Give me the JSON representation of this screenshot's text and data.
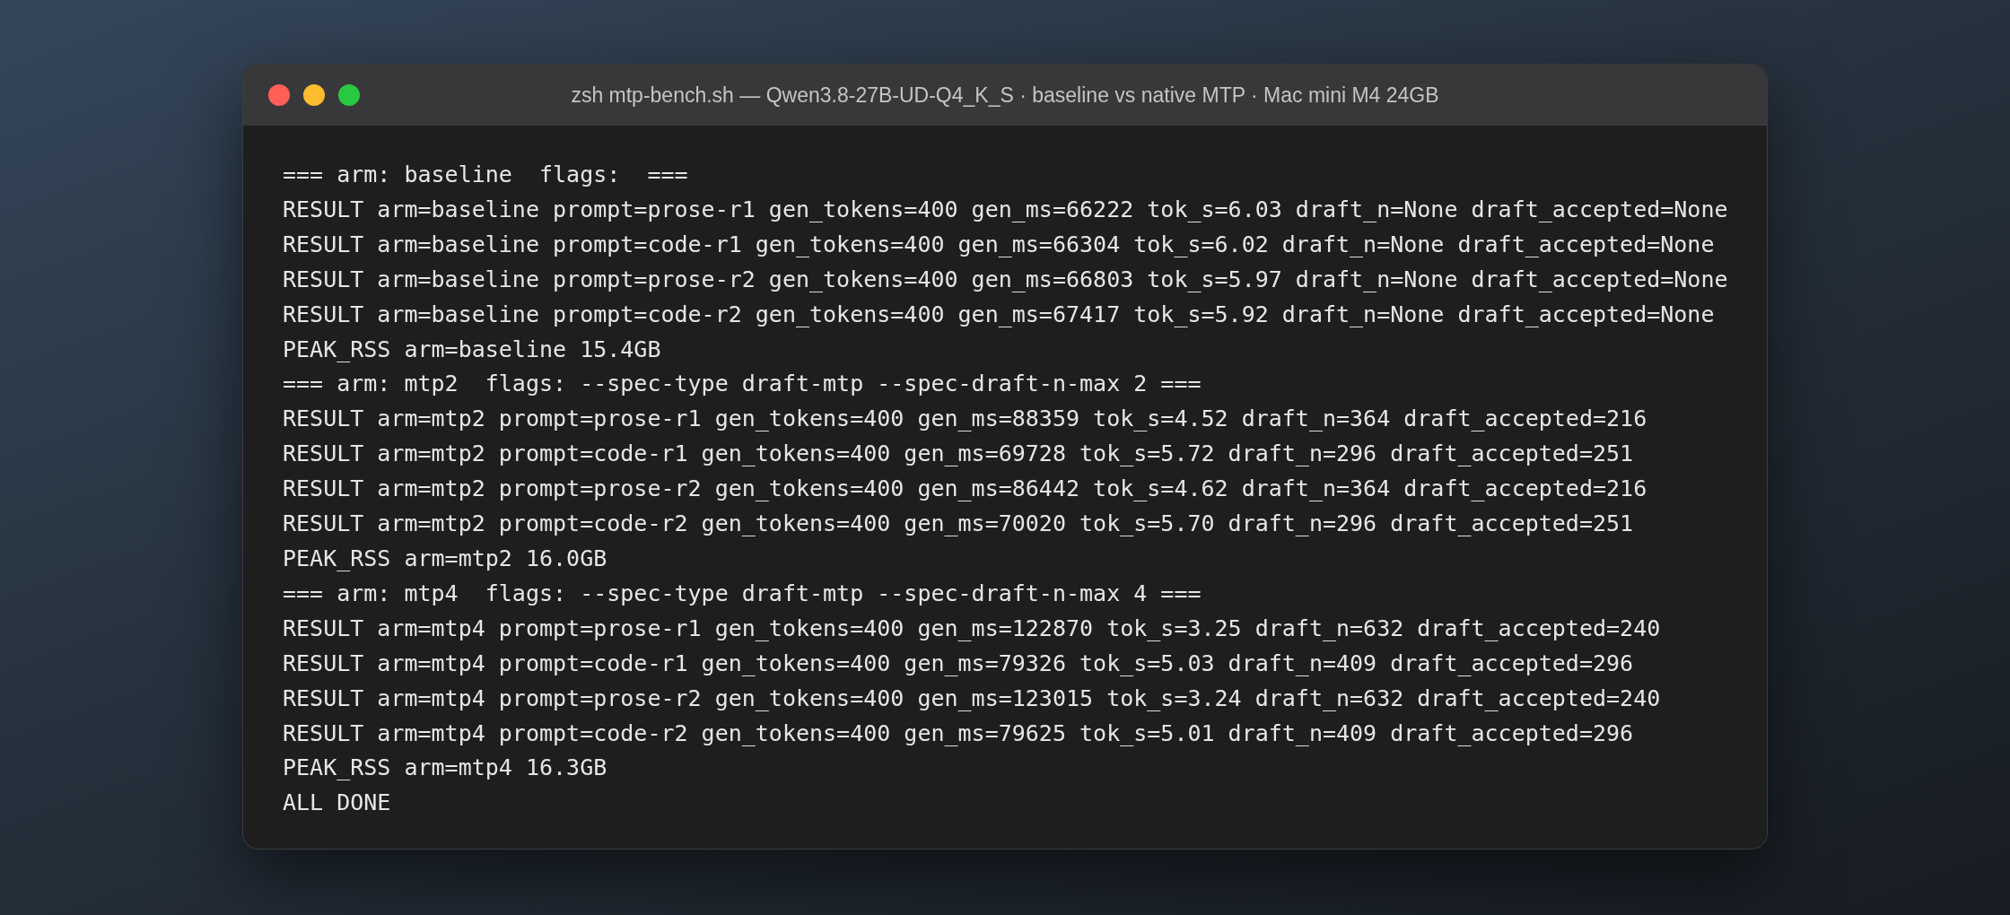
{
  "window": {
    "title": "zsh mtp-bench.sh — Qwen3.8-27B-UD-Q4_K_S · baseline vs native MTP · Mac mini M4 24GB"
  },
  "terminal_lines": [
    "=== arm: baseline  flags:  ===",
    "RESULT arm=baseline prompt=prose-r1 gen_tokens=400 gen_ms=66222 tok_s=6.03 draft_n=None draft_accepted=None",
    "RESULT arm=baseline prompt=code-r1 gen_tokens=400 gen_ms=66304 tok_s=6.02 draft_n=None draft_accepted=None",
    "RESULT arm=baseline prompt=prose-r2 gen_tokens=400 gen_ms=66803 tok_s=5.97 draft_n=None draft_accepted=None",
    "RESULT arm=baseline prompt=code-r2 gen_tokens=400 gen_ms=67417 tok_s=5.92 draft_n=None draft_accepted=None",
    "PEAK_RSS arm=baseline 15.4GB",
    "=== arm: mtp2  flags: --spec-type draft-mtp --spec-draft-n-max 2 ===",
    "RESULT arm=mtp2 prompt=prose-r1 gen_tokens=400 gen_ms=88359 tok_s=4.52 draft_n=364 draft_accepted=216",
    "RESULT arm=mtp2 prompt=code-r1 gen_tokens=400 gen_ms=69728 tok_s=5.72 draft_n=296 draft_accepted=251",
    "RESULT arm=mtp2 prompt=prose-r2 gen_tokens=400 gen_ms=86442 tok_s=4.62 draft_n=364 draft_accepted=216",
    "RESULT arm=mtp2 prompt=code-r2 gen_tokens=400 gen_ms=70020 tok_s=5.70 draft_n=296 draft_accepted=251",
    "PEAK_RSS arm=mtp2 16.0GB",
    "=== arm: mtp4  flags: --spec-type draft-mtp --spec-draft-n-max 4 ===",
    "RESULT arm=mtp4 prompt=prose-r1 gen_tokens=400 gen_ms=122870 tok_s=3.25 draft_n=632 draft_accepted=240",
    "RESULT arm=mtp4 prompt=code-r1 gen_tokens=400 gen_ms=79326 tok_s=5.03 draft_n=409 draft_accepted=296",
    "RESULT arm=mtp4 prompt=prose-r2 gen_tokens=400 gen_ms=123015 tok_s=3.24 draft_n=632 draft_accepted=240",
    "RESULT arm=mtp4 prompt=code-r2 gen_tokens=400 gen_ms=79625 tok_s=5.01 draft_n=409 draft_accepted=296",
    "PEAK_RSS arm=mtp4 16.3GB",
    "ALL DONE"
  ]
}
